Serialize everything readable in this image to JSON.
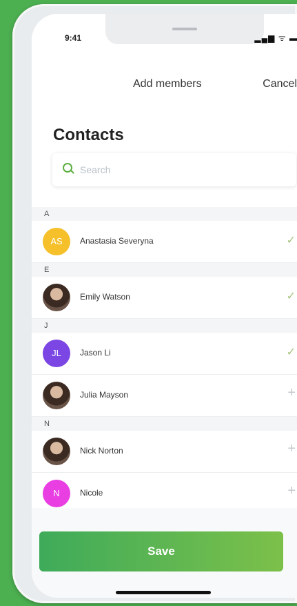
{
  "status_bar": {
    "time": "9:41",
    "icons": "signal-icon wifi-icon battery-icon"
  },
  "nav": {
    "title": "Add members",
    "cancel_label": "Cancel"
  },
  "page": {
    "title": "Contacts"
  },
  "search": {
    "placeholder": "Search"
  },
  "sections": [
    {
      "letter": "A",
      "contacts": [
        {
          "name": "Anastasia Severyna",
          "initials": "AS",
          "avatar_color": "#f5c02a",
          "action": "selected"
        }
      ]
    },
    {
      "letter": "E",
      "contacts": [
        {
          "name": "Emily Watson",
          "initials": "",
          "avatar_color": "",
          "action": "selected"
        }
      ]
    },
    {
      "letter": "J",
      "contacts": [
        {
          "name": "Jason Li",
          "initials": "JL",
          "avatar_color": "#7b46e4",
          "action": "selected"
        },
        {
          "name": "Julia Mayson",
          "initials": "",
          "avatar_color": "",
          "action": "add"
        }
      ]
    },
    {
      "letter": "N",
      "contacts": [
        {
          "name": "Nick Norton",
          "initials": "",
          "avatar_color": "",
          "action": "add"
        },
        {
          "name": "Nicole",
          "initials": "N",
          "avatar_color": "#e83ee2",
          "action": "add"
        }
      ]
    }
  ],
  "icons": {
    "selected": "✓",
    "add": "+"
  },
  "footer": {
    "save_label": "Save"
  },
  "colors": {
    "background": "#4caf50",
    "accent": "#5cae3f"
  }
}
